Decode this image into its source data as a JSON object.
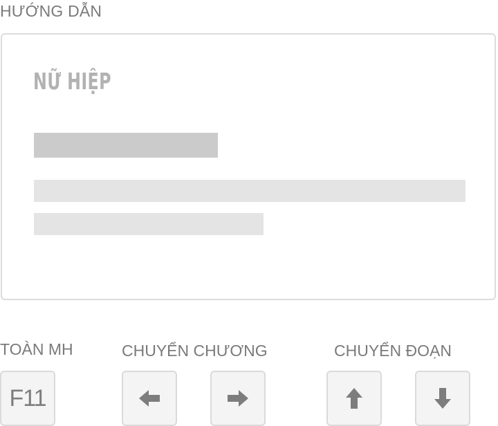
{
  "guide": {
    "title": "HƯỚNG DẪN"
  },
  "preview": {
    "story_title": "NỮ HIỆP"
  },
  "controls": {
    "fullscreen": {
      "label": "TOÀN MH",
      "key": "F11"
    },
    "chapter": {
      "label": "CHUYỂN CHƯƠNG",
      "keys": [
        "arrow-left-icon",
        "arrow-right-icon"
      ]
    },
    "paragraph": {
      "label": "CHUYỂN ĐOẠN",
      "keys": [
        "arrow-up-icon",
        "arrow-down-icon"
      ]
    }
  },
  "colors": {
    "text": "#7a7a7a",
    "title_text": "#b2b2b2",
    "placeholder_dark": "#cbcbcb",
    "placeholder_light": "#e4e4e4",
    "border": "#dcdcdc",
    "key_background": "#f4f4f4",
    "icon": "#7d7d7d"
  }
}
